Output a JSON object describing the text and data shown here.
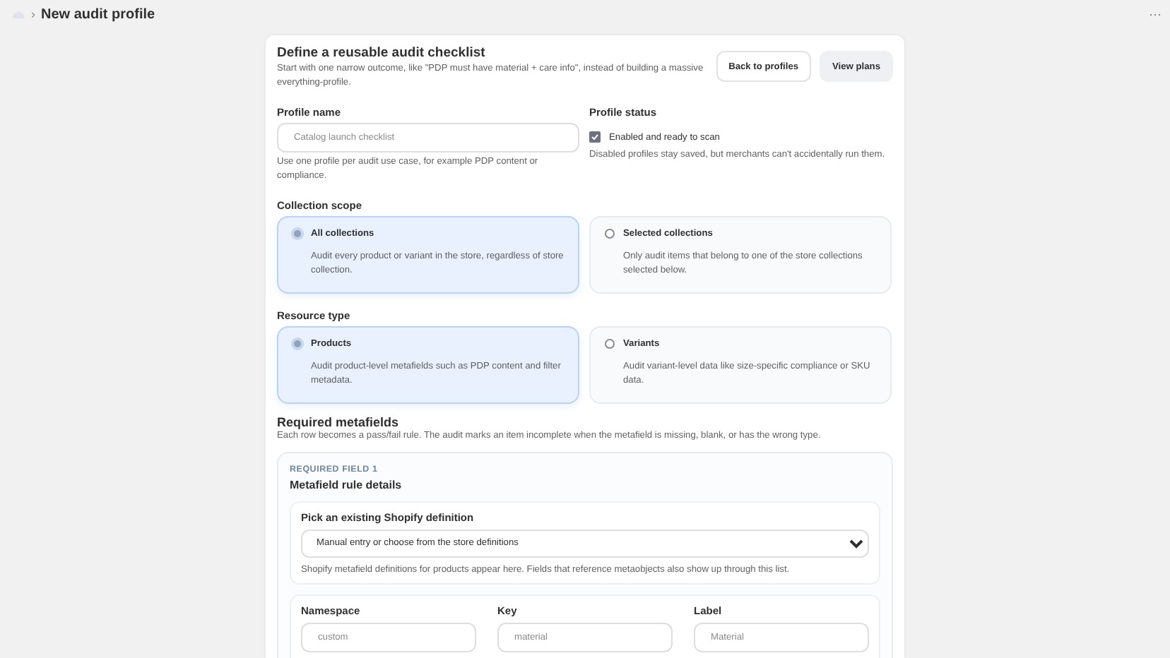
{
  "breadcrumb": {
    "title": "New audit profile",
    "separator": "›",
    "more": "···"
  },
  "header": {
    "title": "Define a reusable audit checklist",
    "description": "Start with one narrow outcome, like \"PDP must have material + care info\", instead of building a massive everything-profile.",
    "buttons": [
      {
        "label": "Back to profiles",
        "kind": "secondary"
      },
      {
        "label": "View plans",
        "kind": "tertiary"
      }
    ]
  },
  "profile_name": {
    "label": "Profile name",
    "placeholder": "Catalog launch checklist",
    "help": "Use one profile per audit use case, for example PDP content or compliance."
  },
  "profile_status": {
    "label": "Profile status",
    "checkbox": {
      "label": "Enabled and ready to scan",
      "checked": true
    },
    "help": "Disabled profiles stay saved, but merchants can't accidentally run them."
  },
  "collection_scope": {
    "label": "Collection scope",
    "options": [
      {
        "title": "All collections",
        "description": "Audit every product or variant in the store, regardless of store collection.",
        "selected": true
      },
      {
        "title": "Selected collections",
        "description": "Only audit items that belong to one of the store collections selected below.",
        "selected": false
      }
    ]
  },
  "resource_type": {
    "label": "Resource type",
    "options": [
      {
        "title": "Products",
        "description": "Audit product-level metafields such as PDP content and filter metadata.",
        "selected": true
      },
      {
        "title": "Variants",
        "description": "Audit variant-level data like size-specific compliance or SKU data.",
        "selected": false
      }
    ]
  },
  "required_metafields": {
    "title": "Required metafields",
    "description": "Each row becomes a pass/fail rule. The audit marks an item incomplete when the metafield is missing, blank, or has the wrong type.",
    "field": {
      "eyebrow": "REQUIRED FIELD 1",
      "title": "Metafield rule details",
      "definition": {
        "label": "Pick an existing Shopify definition",
        "value": "Manual entry or choose from the store definitions",
        "help": "Shopify metafield definitions for products appear here. Fields that reference metaobjects also show up through this list."
      },
      "inputs": [
        {
          "label": "Namespace",
          "placeholder": "custom"
        },
        {
          "label": "Key",
          "placeholder": "material"
        },
        {
          "label": "Label",
          "placeholder": "Material"
        }
      ]
    }
  }
}
